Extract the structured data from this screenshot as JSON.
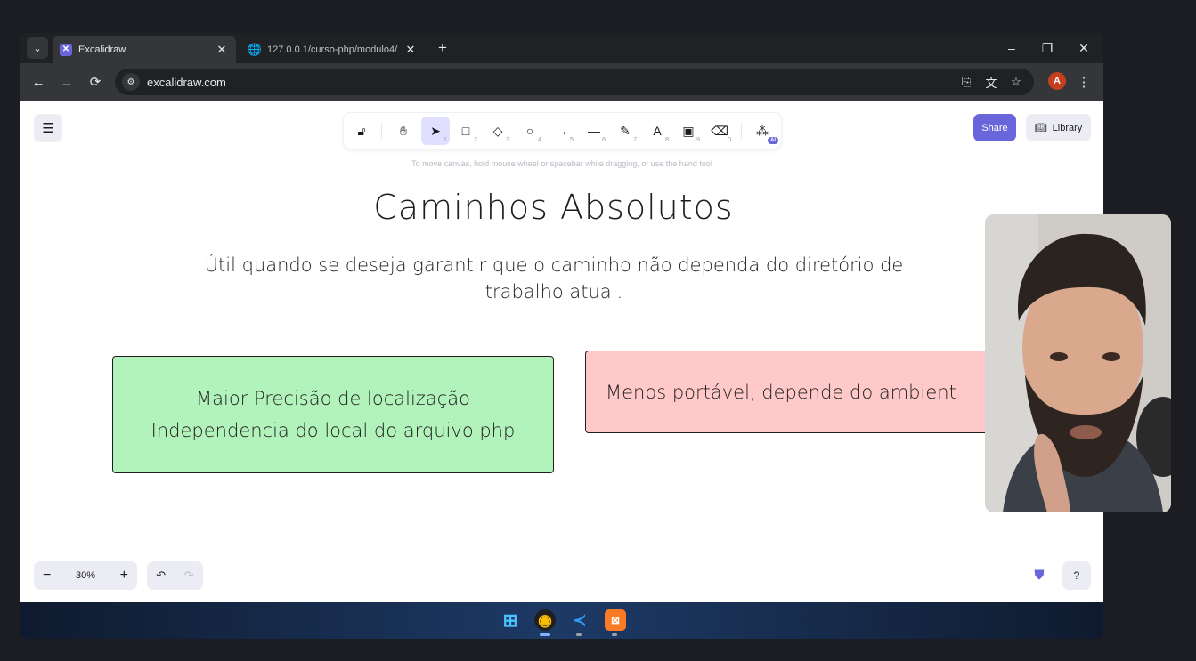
{
  "browser": {
    "tabs": [
      {
        "title": "Excalidraw",
        "active": true
      },
      {
        "title": "127.0.0.1/curso-php/modulo4/",
        "active": false
      }
    ],
    "url": "excalidraw.com",
    "profile_initial": "A"
  },
  "excalidraw": {
    "tools": [
      {
        "name": "lock",
        "key": ""
      },
      {
        "name": "hand",
        "key": ""
      },
      {
        "name": "selection",
        "key": "1"
      },
      {
        "name": "rectangle",
        "key": "2"
      },
      {
        "name": "diamond",
        "key": "3"
      },
      {
        "name": "ellipse",
        "key": "4"
      },
      {
        "name": "arrow",
        "key": "5"
      },
      {
        "name": "line",
        "key": "6"
      },
      {
        "name": "draw",
        "key": "7"
      },
      {
        "name": "text",
        "key": "8"
      },
      {
        "name": "image",
        "key": "9"
      },
      {
        "name": "eraser",
        "key": "0"
      },
      {
        "name": "more-tools",
        "key": ""
      }
    ],
    "ai_badge": "AI",
    "hint": "To move canvas, hold mouse wheel or spacebar while dragging, or use the hand tool",
    "share_label": "Share",
    "library_label": "Library",
    "zoom": "30%"
  },
  "drawing": {
    "title": "Caminhos Absolutos",
    "subtitle_line1": "Útil quando se deseja garantir que o caminho não dependa do diretório de",
    "subtitle_line2": "trabalho atual.",
    "green_card": {
      "line1": "Maior Precisão de localização",
      "line2": "Independencia do local do arquivo php",
      "fill": "#b2f2bb"
    },
    "red_card": {
      "line1": "Menos portável, depende do ambient",
      "fill": "#ffc9c9"
    }
  },
  "colors": {
    "accent": "#6965db",
    "browser_dark": "#202124"
  }
}
